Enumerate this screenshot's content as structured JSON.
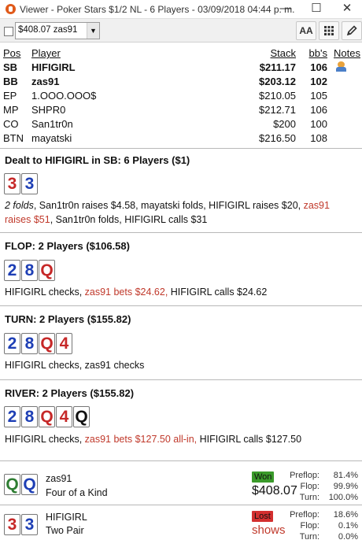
{
  "window": {
    "title": "Viewer - Poker Stars $1/2 NL - 6 Players - 03/09/2018 04:44 p. m.",
    "minimize": "—",
    "maximize": "☐",
    "close": "✕"
  },
  "toolbar": {
    "selector_value": "$408.07 zas91",
    "font_button": "AA",
    "grid_button": "grid-icon",
    "edit_button": "pencil-icon"
  },
  "players_table": {
    "headers": {
      "pos": "Pos",
      "player": "Player",
      "stack": "Stack",
      "bbs": "bb's",
      "notes": "Notes"
    },
    "rows": [
      {
        "pos": "SB",
        "player": "HIFIGIRL",
        "stack": "$211.17",
        "bbs": "106",
        "bold": true,
        "note": true
      },
      {
        "pos": "BB",
        "player": "zas91",
        "stack": "$203.12",
        "bbs": "102",
        "bold": true,
        "note": false
      },
      {
        "pos": "EP",
        "player": "1.OOO.OOO$",
        "stack": "$210.05",
        "bbs": "105",
        "bold": false,
        "note": false
      },
      {
        "pos": "MP",
        "player": "SHPR0",
        "stack": "$212.71",
        "bbs": "106",
        "bold": false,
        "note": false
      },
      {
        "pos": "CO",
        "player": "San1tr0n",
        "stack": "$200",
        "bbs": "100",
        "bold": false,
        "note": false
      },
      {
        "pos": "BTN",
        "player": "mayatski",
        "stack": "$216.50",
        "bbs": "108",
        "bold": false,
        "note": false
      }
    ]
  },
  "preflop": {
    "title": "Dealt to HIFIGIRL in SB: 6 Players ($1)",
    "cards": [
      {
        "rank": "3",
        "color": "#c62828"
      },
      {
        "rank": "3",
        "color": "#1e3fb5"
      }
    ],
    "action_parts": [
      {
        "text": "2 folds",
        "style": "italic"
      },
      {
        "text": ", San1tr0n raises $4.58, mayatski folds, HIFIGIRL raises $20, ",
        "style": "normal"
      },
      {
        "text": "zas91 raises $51",
        "style": "red"
      },
      {
        "text": ", San1tr0n folds, HIFIGIRL calls $31",
        "style": "normal"
      }
    ]
  },
  "flop": {
    "title": "FLOP: 2 Players ($106.58)",
    "cards": [
      {
        "rank": "2",
        "color": "#1e3fb5"
      },
      {
        "rank": "8",
        "color": "#1e3fb5"
      },
      {
        "rank": "Q",
        "color": "#c62828"
      }
    ],
    "action_parts": [
      {
        "text": "HIFIGIRL checks, ",
        "style": "normal"
      },
      {
        "text": "zas91 bets $24.62,",
        "style": "red"
      },
      {
        "text": " HIFIGIRL calls $24.62",
        "style": "normal"
      }
    ]
  },
  "turn": {
    "title": "TURN: 2 Players ($155.82)",
    "cards": [
      {
        "rank": "2",
        "color": "#1e3fb5"
      },
      {
        "rank": "8",
        "color": "#1e3fb5"
      },
      {
        "rank": "Q",
        "color": "#c62828"
      },
      {
        "rank": "4",
        "color": "#c62828"
      }
    ],
    "action_parts": [
      {
        "text": "HIFIGIRL checks, zas91 checks",
        "style": "normal"
      }
    ]
  },
  "river": {
    "title": "RIVER: 2 Players ($155.82)",
    "cards": [
      {
        "rank": "2",
        "color": "#1e3fb5"
      },
      {
        "rank": "8",
        "color": "#1e3fb5"
      },
      {
        "rank": "Q",
        "color": "#c62828"
      },
      {
        "rank": "4",
        "color": "#c62828"
      },
      {
        "rank": "Q",
        "color": "#111111"
      }
    ],
    "action_parts": [
      {
        "text": "HIFIGIRL checks, ",
        "style": "normal"
      },
      {
        "text": "zas91 bets $127.50 all-in,",
        "style": "red"
      },
      {
        "text": " HIFIGIRL calls $127.50",
        "style": "normal"
      }
    ]
  },
  "results": [
    {
      "player": "zas91",
      "hand": "Four of a Kind",
      "cards": [
        {
          "rank": "Q",
          "color": "#2e7d32"
        },
        {
          "rank": "Q",
          "color": "#1e3fb5"
        }
      ],
      "badge": "Won",
      "badge_color": "#3a9a2a",
      "amount": "$408.07",
      "equity": [
        {
          "label": "Preflop:",
          "value": "81.4%"
        },
        {
          "label": "Flop:",
          "value": "99.9%"
        },
        {
          "label": "Turn:",
          "value": "100.0%"
        }
      ]
    },
    {
      "player": "HIFIGIRL",
      "hand": "Two Pair",
      "cards": [
        {
          "rank": "3",
          "color": "#c62828"
        },
        {
          "rank": "3",
          "color": "#1e3fb5"
        }
      ],
      "badge": "Lost",
      "badge_color": "#d32f2f",
      "amount": "shows",
      "equity": [
        {
          "label": "Preflop:",
          "value": "18.6%"
        },
        {
          "label": "Flop:",
          "value": "0.1%"
        },
        {
          "label": "Turn:",
          "value": "0.0%"
        }
      ]
    }
  ]
}
